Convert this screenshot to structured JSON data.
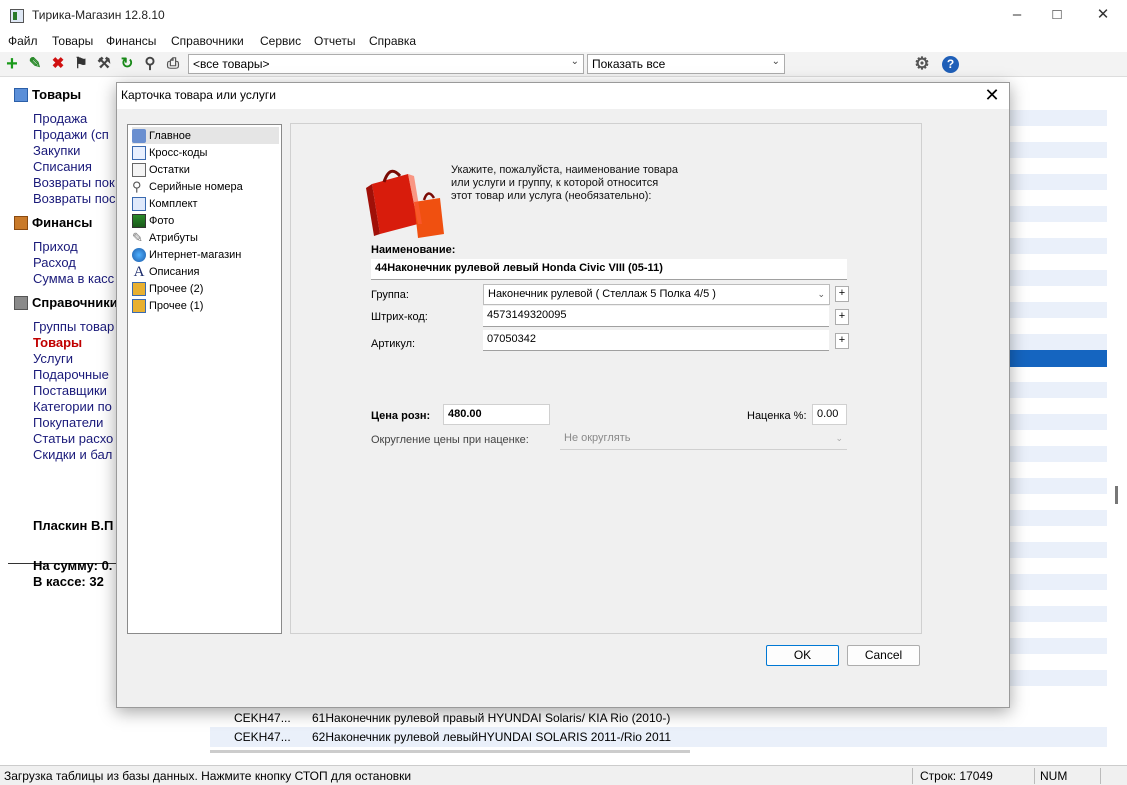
{
  "window": {
    "title": "Тирика-Магазин 12.8.10"
  },
  "menu": [
    "Файл",
    "Товары",
    "Финансы",
    "Справочники",
    "Сервис",
    "Отчеты",
    "Справка"
  ],
  "toolbar": {
    "filter_combo": "<все товары>",
    "show_combo": "Показать все"
  },
  "sidebar": {
    "sections": [
      {
        "title": "Товары",
        "items": [
          "Продажа",
          "Продажи (сп",
          "Закупки",
          "Списания",
          "Возвраты пок",
          "Возвраты пос"
        ]
      },
      {
        "title": "Финансы",
        "items": [
          "Приход",
          "Расход",
          "Сумма в касс"
        ]
      },
      {
        "title": "Справочники",
        "items": [
          "Группы товар",
          "Товары",
          "Услуги",
          "Подарочные",
          "Поставщики",
          "Категории по",
          "Покупатели",
          "Статьи расхо",
          "Скидки и бал"
        ]
      }
    ],
    "active_item": "Товары",
    "user": "Пласкин В.П",
    "sum_label": "На сумму: 0.",
    "cash_label": "В кассе: 32"
  },
  "grid": {
    "rows": [
      {
        "code": "CEKH47...",
        "name": "61Наконечник рулевой правый HYUNDAI Solaris/ KIA Rio (2010-)"
      },
      {
        "code": "CEKH47...",
        "name": "62Наконечник рулевой левыйHYUNDAI SOLARIS 2011-/Rio 2011"
      }
    ]
  },
  "status": {
    "message": "Загрузка таблицы из базы данных. Нажмите кнопку СТОП для остановки",
    "rows": "Строк: 17049",
    "num": "NUM"
  },
  "dialog": {
    "title": "Карточка товара или услуги",
    "nav": [
      "Главное",
      "Кросс-коды",
      "Остатки",
      "Серийные номера",
      "Комплект",
      "Фото",
      "Атрибуты",
      "Интернет-магазин",
      "Описания",
      "Прочее (2)",
      "Прочее (1)"
    ],
    "instruction": [
      "Укажите, пожалуйста, наименование товара",
      "или услуги и группу, к которой относится",
      "этот товар или услуга (необязательно):"
    ],
    "name_label": "Наименование:",
    "name_value": "44Наконечник рулевой левый Honda Civic VIII (05-11)",
    "group_label": "Группа:",
    "group_value": "Наконечник рулевой  ( Стеллаж 5 Полка 4/5 )",
    "barcode_label": "Штрих-код:",
    "barcode_value": "4573149320095",
    "article_label": "Артикул:",
    "article_value": "07050342",
    "price_label": "Цена розн:",
    "price_value": "480.00",
    "markup_label": "Наценка %:",
    "markup_value": "0.00",
    "rounding_label": "Округление цены при наценке:",
    "rounding_value": "Не округлять",
    "plus": "+",
    "ok": "OK",
    "cancel": "Cancel"
  }
}
